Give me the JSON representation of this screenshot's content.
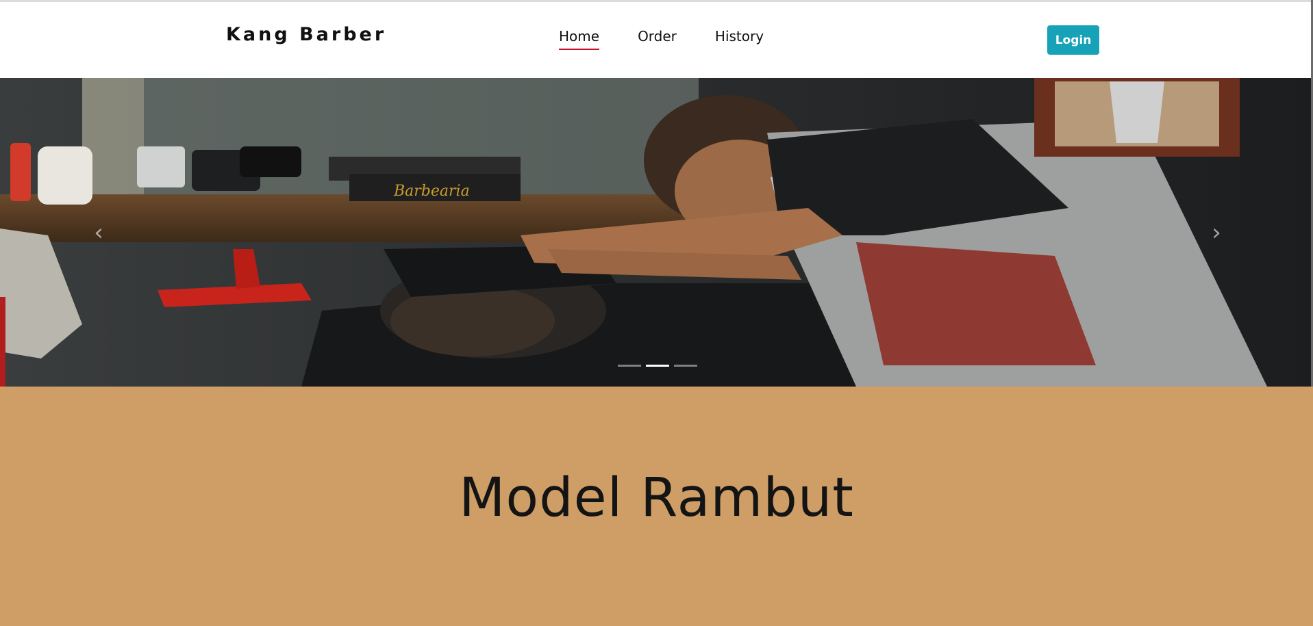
{
  "navbar": {
    "brand": "Kang Barber",
    "links": [
      {
        "label": "Home",
        "active": true
      },
      {
        "label": "Order",
        "active": false
      },
      {
        "label": "History",
        "active": false
      }
    ],
    "login_label": "Login"
  },
  "carousel": {
    "prev_icon": "chevron-left-icon",
    "next_icon": "chevron-right-icon",
    "indicator_count": 3,
    "active_indicator": 2,
    "slide_subject": "barber cutting a customer's hair"
  },
  "section": {
    "title": "Model Rambut"
  },
  "colors": {
    "accent": "#17a2b8",
    "active_underline": "#c8102e",
    "section_bg": "#cf9e66"
  }
}
